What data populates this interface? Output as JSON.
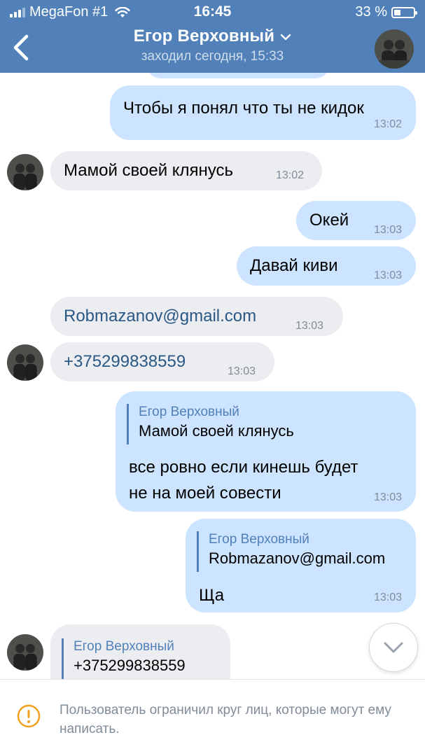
{
  "status_bar": {
    "carrier": "MegaFon #1",
    "time": "16:45",
    "battery": "33 %"
  },
  "header": {
    "title": "Егор Верховный",
    "subtitle": "заходил сегодня, 15:33",
    "icons": [
      "back-chevron-icon",
      "chevron-down-icon",
      "avatar"
    ]
  },
  "messages": [
    {
      "dir": "out",
      "text": "Чтобы я понял что ты не кидок",
      "time": "13:02"
    },
    {
      "dir": "in",
      "text": "Мамой своей клянусь",
      "time": "13:02"
    },
    {
      "dir": "out",
      "text": "Окей",
      "time": "13:03"
    },
    {
      "dir": "out",
      "text": "Давай киви",
      "time": "13:03"
    },
    {
      "dir": "in",
      "text": "Robmazanov@gmail.com",
      "time": "13:03"
    },
    {
      "dir": "in",
      "text": "+375299838559",
      "time": "13:03"
    },
    {
      "dir": "out",
      "reply_name": "Егор Верховный",
      "reply_text": "Мамой своей клянусь",
      "text_line1": "все ровно если кинешь будет",
      "text_line2": "не на моей совести",
      "time": "13:03"
    },
    {
      "dir": "out",
      "reply_name": "Егор Верховный",
      "reply_text": "Robmazanov@gmail.com",
      "text": "Ща",
      "time": "13:03"
    },
    {
      "dir": "in",
      "reply_name": "Егор Верховный",
      "reply_text": "+375299838559"
    }
  ],
  "footer": {
    "notice": "Пользователь ограничил круг лиц, которые могут ему написать.",
    "icon": "warning-icon"
  },
  "colors": {
    "header_bg": "#5181b8",
    "outgoing_bubble": "#cce4ff",
    "incoming_bubble": "#ebedf0",
    "accent": "#5181b8",
    "link": "#2a5885",
    "warning": "#f2a11e"
  }
}
